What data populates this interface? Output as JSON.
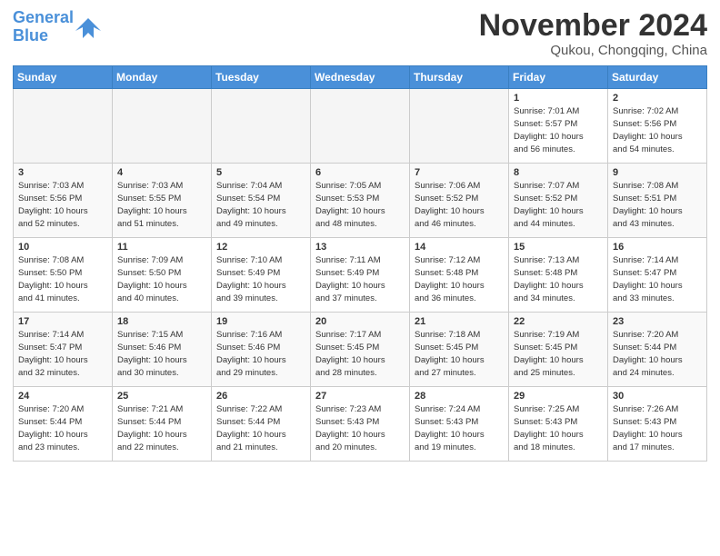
{
  "header": {
    "logo_line1": "General",
    "logo_line2": "Blue",
    "month_title": "November 2024",
    "location": "Qukou, Chongqing, China"
  },
  "weekdays": [
    "Sunday",
    "Monday",
    "Tuesday",
    "Wednesday",
    "Thursday",
    "Friday",
    "Saturday"
  ],
  "weeks": [
    [
      {
        "day": "",
        "info": ""
      },
      {
        "day": "",
        "info": ""
      },
      {
        "day": "",
        "info": ""
      },
      {
        "day": "",
        "info": ""
      },
      {
        "day": "",
        "info": ""
      },
      {
        "day": "1",
        "info": "Sunrise: 7:01 AM\nSunset: 5:57 PM\nDaylight: 10 hours\nand 56 minutes."
      },
      {
        "day": "2",
        "info": "Sunrise: 7:02 AM\nSunset: 5:56 PM\nDaylight: 10 hours\nand 54 minutes."
      }
    ],
    [
      {
        "day": "3",
        "info": "Sunrise: 7:03 AM\nSunset: 5:56 PM\nDaylight: 10 hours\nand 52 minutes."
      },
      {
        "day": "4",
        "info": "Sunrise: 7:03 AM\nSunset: 5:55 PM\nDaylight: 10 hours\nand 51 minutes."
      },
      {
        "day": "5",
        "info": "Sunrise: 7:04 AM\nSunset: 5:54 PM\nDaylight: 10 hours\nand 49 minutes."
      },
      {
        "day": "6",
        "info": "Sunrise: 7:05 AM\nSunset: 5:53 PM\nDaylight: 10 hours\nand 48 minutes."
      },
      {
        "day": "7",
        "info": "Sunrise: 7:06 AM\nSunset: 5:52 PM\nDaylight: 10 hours\nand 46 minutes."
      },
      {
        "day": "8",
        "info": "Sunrise: 7:07 AM\nSunset: 5:52 PM\nDaylight: 10 hours\nand 44 minutes."
      },
      {
        "day": "9",
        "info": "Sunrise: 7:08 AM\nSunset: 5:51 PM\nDaylight: 10 hours\nand 43 minutes."
      }
    ],
    [
      {
        "day": "10",
        "info": "Sunrise: 7:08 AM\nSunset: 5:50 PM\nDaylight: 10 hours\nand 41 minutes."
      },
      {
        "day": "11",
        "info": "Sunrise: 7:09 AM\nSunset: 5:50 PM\nDaylight: 10 hours\nand 40 minutes."
      },
      {
        "day": "12",
        "info": "Sunrise: 7:10 AM\nSunset: 5:49 PM\nDaylight: 10 hours\nand 39 minutes."
      },
      {
        "day": "13",
        "info": "Sunrise: 7:11 AM\nSunset: 5:49 PM\nDaylight: 10 hours\nand 37 minutes."
      },
      {
        "day": "14",
        "info": "Sunrise: 7:12 AM\nSunset: 5:48 PM\nDaylight: 10 hours\nand 36 minutes."
      },
      {
        "day": "15",
        "info": "Sunrise: 7:13 AM\nSunset: 5:48 PM\nDaylight: 10 hours\nand 34 minutes."
      },
      {
        "day": "16",
        "info": "Sunrise: 7:14 AM\nSunset: 5:47 PM\nDaylight: 10 hours\nand 33 minutes."
      }
    ],
    [
      {
        "day": "17",
        "info": "Sunrise: 7:14 AM\nSunset: 5:47 PM\nDaylight: 10 hours\nand 32 minutes."
      },
      {
        "day": "18",
        "info": "Sunrise: 7:15 AM\nSunset: 5:46 PM\nDaylight: 10 hours\nand 30 minutes."
      },
      {
        "day": "19",
        "info": "Sunrise: 7:16 AM\nSunset: 5:46 PM\nDaylight: 10 hours\nand 29 minutes."
      },
      {
        "day": "20",
        "info": "Sunrise: 7:17 AM\nSunset: 5:45 PM\nDaylight: 10 hours\nand 28 minutes."
      },
      {
        "day": "21",
        "info": "Sunrise: 7:18 AM\nSunset: 5:45 PM\nDaylight: 10 hours\nand 27 minutes."
      },
      {
        "day": "22",
        "info": "Sunrise: 7:19 AM\nSunset: 5:45 PM\nDaylight: 10 hours\nand 25 minutes."
      },
      {
        "day": "23",
        "info": "Sunrise: 7:20 AM\nSunset: 5:44 PM\nDaylight: 10 hours\nand 24 minutes."
      }
    ],
    [
      {
        "day": "24",
        "info": "Sunrise: 7:20 AM\nSunset: 5:44 PM\nDaylight: 10 hours\nand 23 minutes."
      },
      {
        "day": "25",
        "info": "Sunrise: 7:21 AM\nSunset: 5:44 PM\nDaylight: 10 hours\nand 22 minutes."
      },
      {
        "day": "26",
        "info": "Sunrise: 7:22 AM\nSunset: 5:44 PM\nDaylight: 10 hours\nand 21 minutes."
      },
      {
        "day": "27",
        "info": "Sunrise: 7:23 AM\nSunset: 5:43 PM\nDaylight: 10 hours\nand 20 minutes."
      },
      {
        "day": "28",
        "info": "Sunrise: 7:24 AM\nSunset: 5:43 PM\nDaylight: 10 hours\nand 19 minutes."
      },
      {
        "day": "29",
        "info": "Sunrise: 7:25 AM\nSunset: 5:43 PM\nDaylight: 10 hours\nand 18 minutes."
      },
      {
        "day": "30",
        "info": "Sunrise: 7:26 AM\nSunset: 5:43 PM\nDaylight: 10 hours\nand 17 minutes."
      }
    ]
  ]
}
